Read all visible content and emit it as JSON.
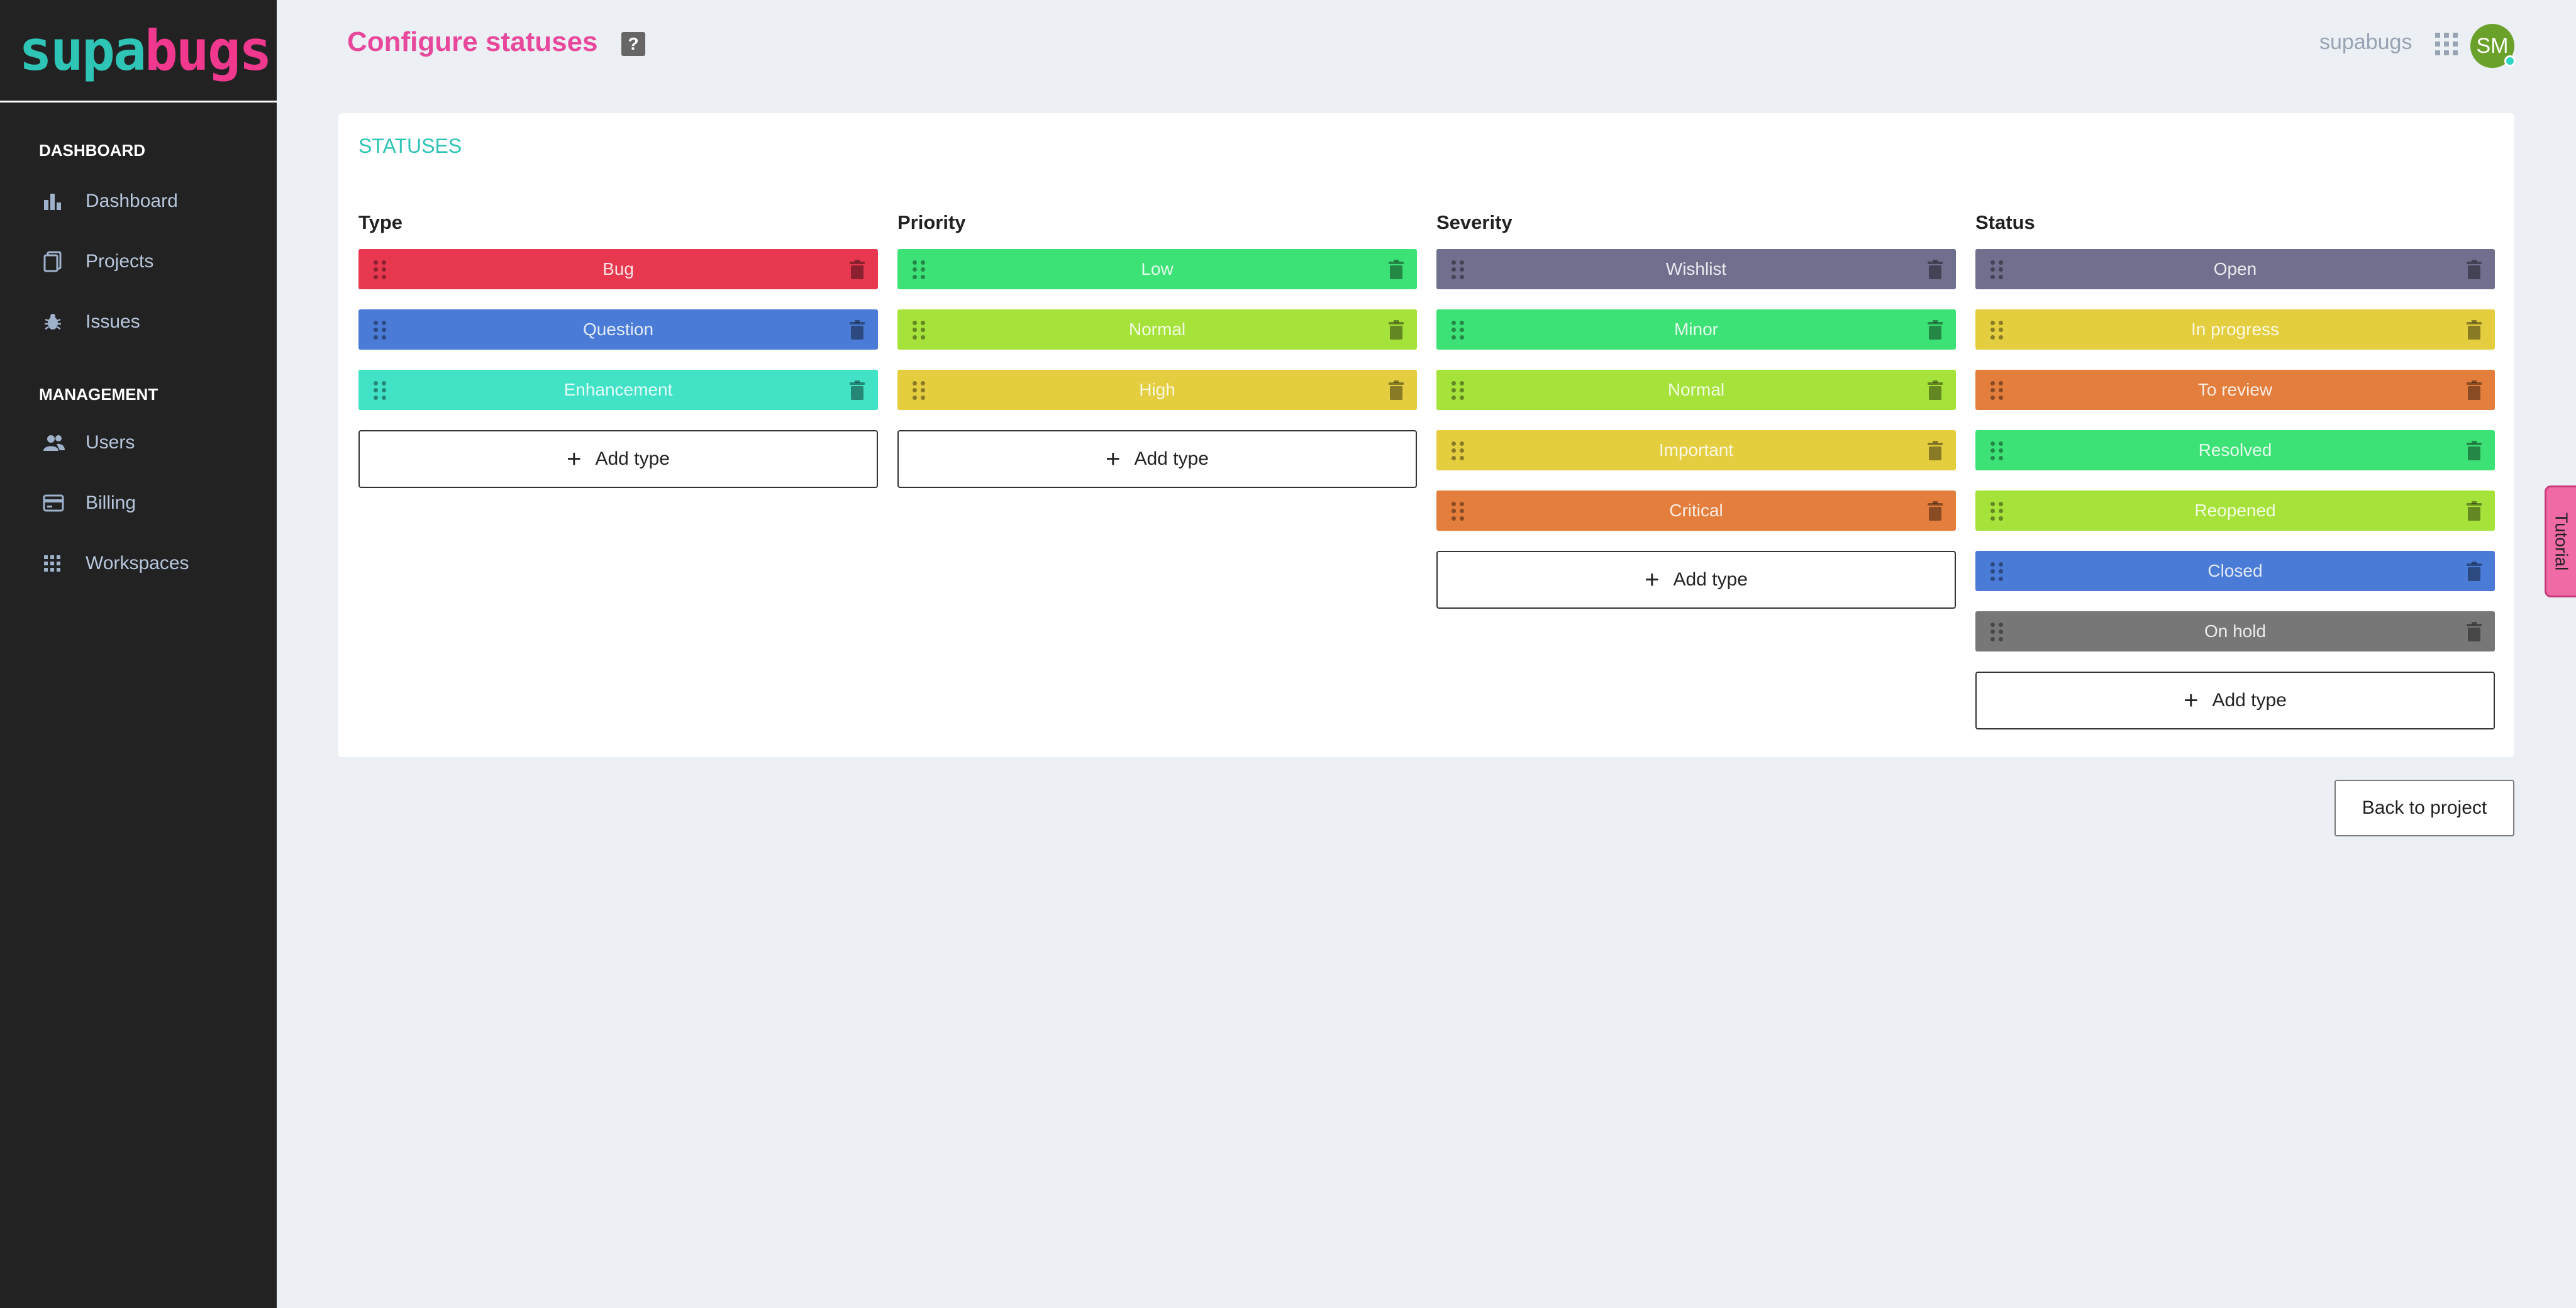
{
  "app": {
    "logo_part1": "supa",
    "logo_part2": "bugs"
  },
  "sidebar": {
    "sections": [
      {
        "title": "DASHBOARD",
        "items": [
          {
            "label": "Dashboard",
            "icon": "bar-chart-icon"
          },
          {
            "label": "Projects",
            "icon": "documents-icon"
          },
          {
            "label": "Issues",
            "icon": "bug-icon"
          }
        ]
      },
      {
        "title": "MANAGEMENT",
        "items": [
          {
            "label": "Users",
            "icon": "users-icon"
          },
          {
            "label": "Billing",
            "icon": "credit-card-icon"
          },
          {
            "label": "Workspaces",
            "icon": "grid-icon"
          }
        ]
      }
    ]
  },
  "header": {
    "title": "Configure statuses",
    "help": "?",
    "workspace": "supabugs",
    "avatar_initials": "SM"
  },
  "card": {
    "title": "STATUSES",
    "add_label": "Add type",
    "columns": [
      {
        "title": "Type",
        "items": [
          {
            "label": "Bug",
            "color": "#e8384f"
          },
          {
            "label": "Question",
            "color": "#4a7bd6"
          },
          {
            "label": "Enhancement",
            "color": "#41e2c6"
          }
        ]
      },
      {
        "title": "Priority",
        "items": [
          {
            "label": "Low",
            "color": "#3de276"
          },
          {
            "label": "Normal",
            "color": "#a5e23a"
          },
          {
            "label": "High",
            "color": "#e4cd3f"
          }
        ]
      },
      {
        "title": "Severity",
        "items": [
          {
            "label": "Wishlist",
            "color": "#70708e"
          },
          {
            "label": "Minor",
            "color": "#3de276"
          },
          {
            "label": "Normal",
            "color": "#a5e23a"
          },
          {
            "label": "Important",
            "color": "#e4cd3f"
          },
          {
            "label": "Critical",
            "color": "#e37e3d"
          }
        ]
      },
      {
        "title": "Status",
        "items": [
          {
            "label": "Open",
            "color": "#70708e"
          },
          {
            "label": "In progress",
            "color": "#e4cd3f"
          },
          {
            "label": "To review",
            "color": "#e37e3d"
          },
          {
            "label": "Resolved",
            "color": "#3de276"
          },
          {
            "label": "Reopened",
            "color": "#a5e23a"
          },
          {
            "label": "Closed",
            "color": "#4a7bd6"
          },
          {
            "label": "On hold",
            "color": "#777777"
          }
        ]
      }
    ]
  },
  "back_button": "Back to project",
  "tutorial": "Tutorial"
}
